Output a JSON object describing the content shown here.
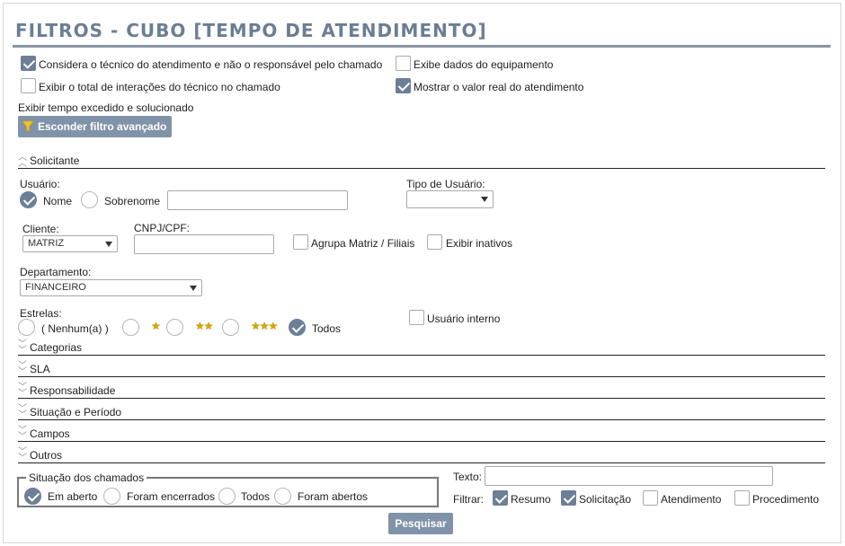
{
  "header": {
    "title": "FILTROS - CUBO [TEMPO DE ATENDIMENTO]"
  },
  "options": {
    "considera_tecnico": {
      "label": "Considera o técnico do atendimento e não o responsável pelo chamado",
      "checked": true
    },
    "exibe_equipamento": {
      "label": "Exibe dados do equipamento",
      "checked": false
    },
    "exibir_interacoes": {
      "label": "Exibir o total de interações do técnico no chamado",
      "checked": false
    },
    "mostrar_valor_real": {
      "label": "Mostrar o valor real do atendimento",
      "checked": true
    },
    "tempo_excedido_text": "Exibir tempo excedido e solucionado"
  },
  "advanced_filter_button": {
    "label": "Esconder filtro avançado",
    "icon": "funnel-icon"
  },
  "solicitante": {
    "section_label": "Solicitante",
    "usuario_label": "Usuário:",
    "nome_label": "Nome",
    "sobrenome_label": "Sobrenome",
    "usuario_value": "",
    "tipo_usuario_label": "Tipo de Usuário:",
    "tipo_usuario_value": "",
    "cliente_label": "Cliente:",
    "cliente_value": "MATRIZ",
    "cnpj_label": "CNPJ/CPF:",
    "cnpj_value": "",
    "agrupa_label": "Agrupa Matriz / Filiais",
    "exibir_inativos_label": "Exibir inativos",
    "departamento_label": "Departamento:",
    "departamento_value": "FINANCEIRO",
    "estrelas_label": "Estrelas:",
    "nenhum_label": "( Nenhum(a) )",
    "todos_label": "Todos",
    "usuario_interno_label": "Usuário interno",
    "star_glyph_1": "★",
    "star_glyph_2": "★★",
    "star_glyph_3": "★★★"
  },
  "sections": [
    "Categorias",
    "SLA",
    "Responsabilidade",
    "Situação e Período",
    "Campos",
    "Outros"
  ],
  "situacao": {
    "legend": "Situação dos chamados",
    "options": [
      "Em aberto",
      "Foram encerrados",
      "Todos",
      "Foram abertos"
    ],
    "selected": "Em aberto"
  },
  "texto": {
    "label": "Texto:",
    "value": ""
  },
  "filtrar": {
    "label": "Filtrar:",
    "options": [
      {
        "label": "Resumo",
        "checked": true
      },
      {
        "label": "Solicitação",
        "checked": true
      },
      {
        "label": "Atendimento",
        "checked": false
      },
      {
        "label": "Procedimento",
        "checked": false
      }
    ]
  },
  "pesquisar_button": {
    "label": "Pesquisar"
  },
  "colors": {
    "accent": "#6c7f96",
    "title": "#6b7e93",
    "button": "#8093a8"
  }
}
